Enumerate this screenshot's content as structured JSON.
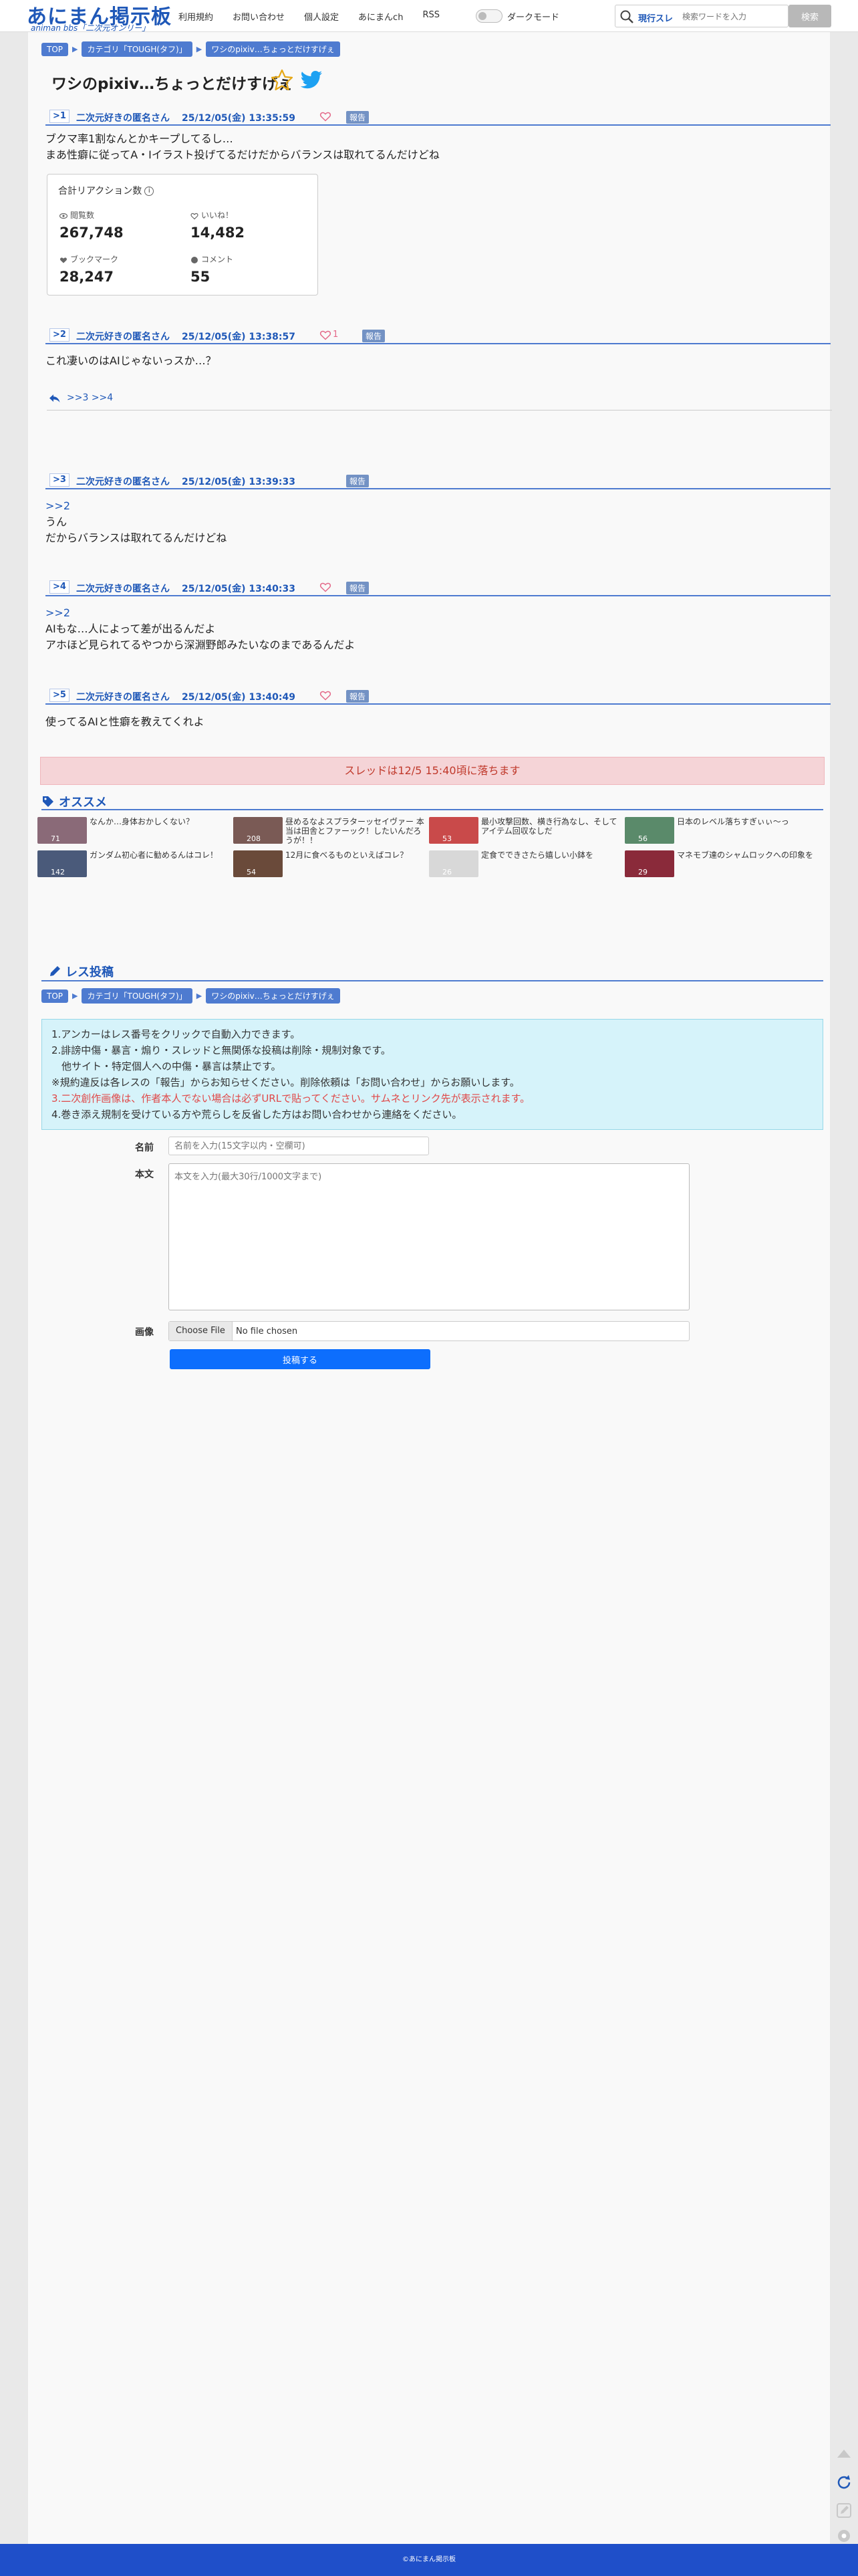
{
  "header": {
    "logo_main": "あにまん掲示板",
    "logo_sub": "animan bbs「二次元オンリー」",
    "nav": [
      "利用規約",
      "お問い合わせ",
      "個人設定",
      "あにまんch",
      "RSS"
    ],
    "dark_mode_label": "ダークモード",
    "search_scope": "現行スレ",
    "search_placeholder": "検索ワードを入力",
    "search_button": "検索"
  },
  "breadcrumb": [
    "TOP",
    "カテゴリ「TOUGH(タフ)」",
    "ワシのpixiv…ちょっとだけすげぇ"
  ],
  "thread_title": "ワシのpixiv…ちょっとだけすげぇ",
  "posts": [
    {
      "num": "1",
      "name": "二次元好きの匿名さん",
      "date": "25/12/05(金) 13:35:59",
      "likes": "",
      "report": "報告",
      "lines": [
        "ブクマ率1割なんとかキープしてるし…",
        "まあ性癖に従ってA・Iイラスト投げてるだけだからバランスは取れてるんだけどね"
      ]
    },
    {
      "num": "2",
      "name": "二次元好きの匿名さん",
      "date": "25/12/05(金) 13:38:57",
      "likes": "1",
      "report": "報告",
      "lines": [
        "これ凄いのはAIじゃないっスか…？"
      ]
    },
    {
      "num": "3",
      "name": "二次元好きの匿名さん",
      "date": "25/12/05(金) 13:39:33",
      "likes": "",
      "report": "報告",
      "anchor": ">>2",
      "lines": [
        "うん",
        "だからバランスは取れてるんだけどね"
      ]
    },
    {
      "num": "4",
      "name": "二次元好きの匿名さん",
      "date": "25/12/05(金) 13:40:33",
      "likes": "",
      "report": "報告",
      "anchor": ">>2",
      "lines": [
        "AIもな…人によって差が出るんだよ",
        "アホほど見られてるやつから深淵野郎みたいなのまであるんだよ"
      ]
    },
    {
      "num": "5",
      "name": "二次元好きの匿名さん",
      "date": "25/12/05(金) 13:40:49",
      "likes": "",
      "report": "報告",
      "lines": [
        "使ってるAIと性癖を教えてくれよ"
      ]
    }
  ],
  "reactions": {
    "title": "合計リアクション数",
    "views_label": "閲覧数",
    "views": "267,748",
    "likes_label": "いいね！",
    "likes": "14,482",
    "bookmarks_label": "ブックマーク",
    "bookmarks": "28,247",
    "comments_label": "コメント",
    "comments": "55"
  },
  "replies": ">>3 >>4",
  "fall_notice": "スレッドは12/5 15:40頃に落ちます",
  "recommend": {
    "title": "オススメ",
    "items": [
      {
        "text": "なんか…身体おかしくない？",
        "count": "71",
        "color": "#8a6a78"
      },
      {
        "text": "昼めるなよスプラターッセイヴァー 本当は田舎とファーック！したいんだろうが！！",
        "count": "208",
        "color": "#7a5a55"
      },
      {
        "text": "最小攻撃回数、横き行為なし、そしてアイテム回収なしだ",
        "count": "53",
        "color": "#c94a4a"
      },
      {
        "text": "日本のレベル落ちすぎぃぃ〜っ",
        "count": "56",
        "color": "#5a8a6a"
      },
      {
        "text": "ガンダム初心者に勧めるんはコレ！",
        "count": "142",
        "color": "#4a5a7a"
      },
      {
        "text": "12月に食べるものといえばコレ？",
        "count": "54",
        "color": "#6a4a3a"
      },
      {
        "text": "定食でできさたら嬉しい小鉢を",
        "count": "26",
        "color": "#d8d8d8"
      },
      {
        "text": "マネモブ達のシャムロックへの印象を",
        "count": "29",
        "color": "#8a2a3a"
      }
    ]
  },
  "post_form": {
    "title": "レス投稿",
    "rules": [
      "1.アンカーはレス番号をクリックで自動入力できます。",
      "2.誹謗中傷・暴言・煽り・スレッドと無関係な投稿は削除・規制対象です。",
      "　他サイト・特定個人への中傷・暴言は禁止です。",
      "※規約違反は各レスの「報告」からお知らせください。削除依頼は「お問い合わせ」からお願いします。",
      "3.二次創作画像は、作者本人でない場合は必ずURLで貼ってください。サムネとリンク先が表示されます。",
      "4.巻き添え規制を受けている方や荒らしを反省した方はお問い合わせから連絡をください。"
    ],
    "name_label": "名前",
    "name_placeholder": "名前を入力(15文字以内・空欄可)",
    "body_label": "本文",
    "body_placeholder": "本文を入力(最大30行/1000文字まで)",
    "image_label": "画像",
    "file_button": "Choose File",
    "file_status": "No file chosen",
    "submit": "投稿する"
  },
  "footer": "©あにまん掲示板"
}
